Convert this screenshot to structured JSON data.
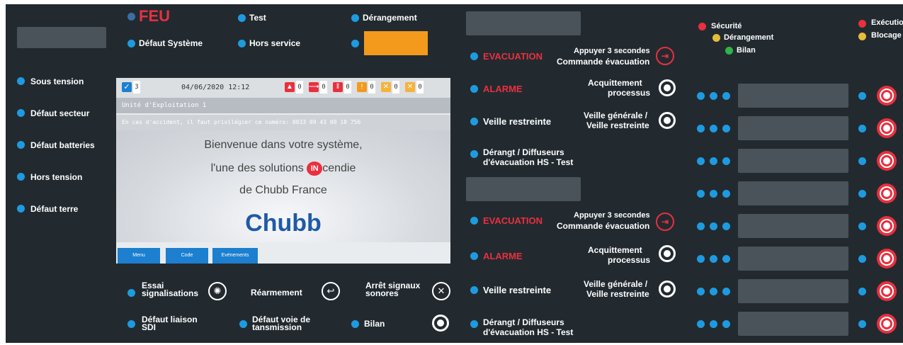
{
  "header": {
    "feu": "FEU",
    "test": "Test",
    "derangement": "Dérangement",
    "defaut_systeme": "Défaut Système",
    "hors_service": "Hors service"
  },
  "left": {
    "items": [
      "Sous tension",
      "Défaut secteur",
      "Défaut batteries",
      "Hors tension",
      "Défaut terre"
    ]
  },
  "screen": {
    "counter": "3",
    "datetime": "04/06/2020 12:12",
    "counts": [
      "0",
      "0",
      "0",
      "0",
      "0",
      "0"
    ],
    "unit": "Unité d'Exploitation 1",
    "accident": "En cas d'accident, il faut privilégier ce numéro: 0033 09 43 00 18 756",
    "welcome1": "Bienvenue dans votre système,",
    "welcome2a": "l'une des solutions ",
    "welcome2logo": "IN",
    "welcome2b": "cendie",
    "welcome3": "de Chubb France",
    "brand": "Chubb",
    "buttons": [
      "Menu",
      "Code",
      "Evénements"
    ]
  },
  "bottom": {
    "essai": "Essai signalisations",
    "rearmement": "Réarmement",
    "arret": "Arrêt signaux sonores",
    "defaut_liaison": "Défaut liaison SDI",
    "defaut_voie": "Défaut voie de tansmission",
    "bilan": "Bilan"
  },
  "mid": {
    "evacuation": "EVACUATION",
    "appuyer_line1": "Appuyer 3 secondes",
    "commande_evac": "Commande évacuation",
    "alarme": "ALARME",
    "acquittement": "Acquittement",
    "processus": "processus",
    "veille_restreinte": "Veille restreinte",
    "veille_generale": "Veille générale /",
    "veille_restreinte2": "Veille restreinte",
    "derangt": "Dérangt / Diffuseurs",
    "evac_hs": "d'évacuation HS - Test"
  },
  "legend": {
    "securite": "Sécurité",
    "derangement": "Dérangement",
    "bilan": "Bilan",
    "execution": "Exécution",
    "blocage": "Blocage"
  },
  "colors": {
    "panel": "#222a30",
    "blue_led": "#1e9be0",
    "red": "#e8303e",
    "orange": "#f39a1c",
    "yellow": "#e6bd3a",
    "green": "#2fb34a"
  }
}
